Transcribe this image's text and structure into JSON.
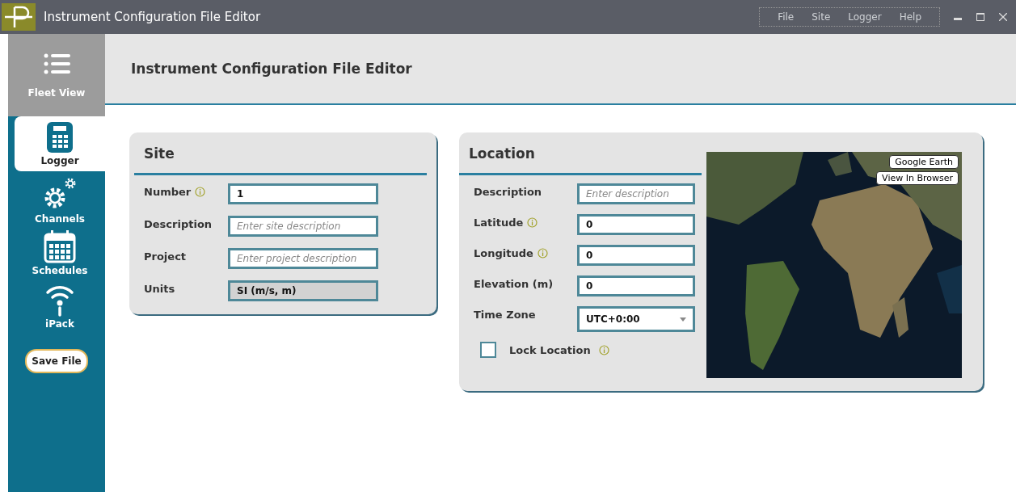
{
  "window": {
    "title": "Instrument Configuration File Editor",
    "menu": [
      "File",
      "Site",
      "Logger",
      "Help"
    ]
  },
  "sidebar": {
    "top_item": {
      "label": "Fleet View"
    },
    "items": [
      {
        "label": "Logger",
        "kind": "logger",
        "selected": true
      },
      {
        "label": "Channels",
        "kind": "gears",
        "selected": false
      },
      {
        "label": "Schedules",
        "kind": "calendar",
        "selected": false
      },
      {
        "label": "iPack",
        "kind": "wireless",
        "selected": false
      }
    ],
    "save_button": "Save File"
  },
  "header": {
    "title": "Instrument Configuration File Editor"
  },
  "site": {
    "title": "Site",
    "fields": [
      {
        "label": "Number",
        "info": true,
        "kind": "text",
        "value": "1"
      },
      {
        "label": "Description",
        "info": false,
        "kind": "text",
        "placeholder": "Enter site description"
      },
      {
        "label": "Project",
        "info": false,
        "kind": "text",
        "placeholder": "Enter project description"
      },
      {
        "label": "Units",
        "info": false,
        "kind": "readonly",
        "value": "SI (m/s, m)"
      }
    ]
  },
  "location": {
    "title": "Location",
    "fields": [
      {
        "label": "Description",
        "info": false,
        "kind": "text",
        "placeholder": "Enter description"
      },
      {
        "label": "Latitude",
        "info": true,
        "kind": "text",
        "value": "0"
      },
      {
        "label": "Longitude",
        "info": true,
        "kind": "text",
        "value": "0"
      },
      {
        "label": "Elevation (m)",
        "info": false,
        "kind": "text",
        "value": "0"
      },
      {
        "label": "Time Zone",
        "info": false,
        "kind": "select",
        "value": "UTC+0:00"
      }
    ],
    "lock": {
      "label": "Lock Location",
      "checked": false,
      "info": true
    },
    "map": {
      "kind": "picture",
      "buttons": [
        "Google Earth",
        "View In Browser"
      ]
    }
  }
}
